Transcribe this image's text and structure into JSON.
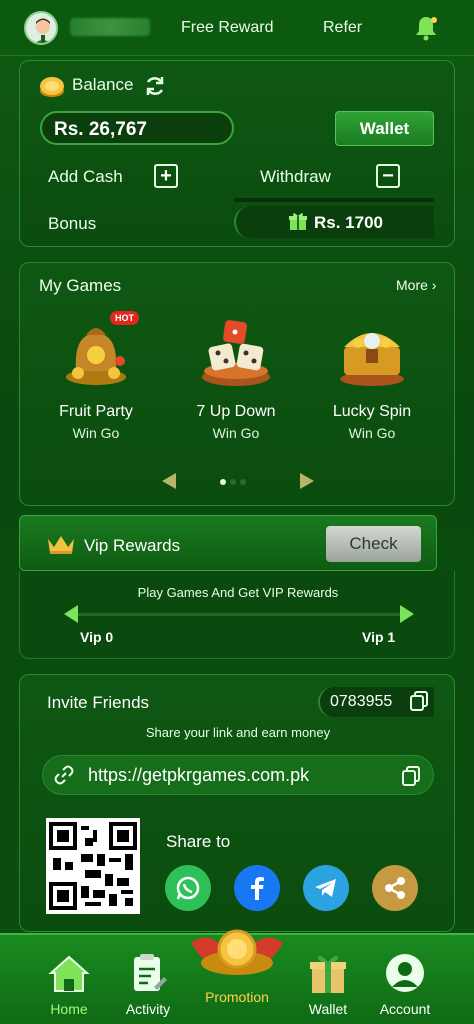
{
  "header": {
    "nav": [
      {
        "label": "Free Reward"
      },
      {
        "label": "Refer"
      }
    ],
    "icons": {
      "avatar": "user-avatar-icon",
      "bell": "bell-icon"
    }
  },
  "balance": {
    "label": "Balance",
    "amount": "Rs. 26,767",
    "wallet_button": "Wallet",
    "add_cash": "Add Cash",
    "withdraw": "Withdraw",
    "bonus_label": "Bonus",
    "bonus_value": "Rs. 1700"
  },
  "games": {
    "title": "My Games",
    "more": "More",
    "items": [
      {
        "name": "Fruit Party",
        "sub": "Win Go",
        "badge": "HOT"
      },
      {
        "name": "7 Up Down",
        "sub": "Win Go"
      },
      {
        "name": "Lucky Spin",
        "sub": "Win Go"
      }
    ]
  },
  "vip": {
    "title": "Vip Rewards",
    "check_button": "Check",
    "caption": "Play Games And Get VIP Rewards",
    "start_level": "Vip 0",
    "end_level": "Vip 1"
  },
  "invite": {
    "title": "Invite Friends",
    "code": "0783955",
    "caption": "Share your link and earn money",
    "link": "https://getpkrgames.com.pk",
    "share_to": "Share to",
    "share_targets": [
      "whatsapp-icon",
      "facebook-icon",
      "telegram-icon",
      "share-icon"
    ]
  },
  "bottom_nav": {
    "items": [
      {
        "label": "Home"
      },
      {
        "label": "Activity"
      },
      {
        "label": "Promotion"
      },
      {
        "label": "Wallet"
      },
      {
        "label": "Account"
      }
    ]
  },
  "colors": {
    "background": "#0b4a0f",
    "accent": "#2fa336",
    "home_label": "#9dff7a",
    "promotion_label": "#ffd24a",
    "hot": "#e0281e"
  }
}
